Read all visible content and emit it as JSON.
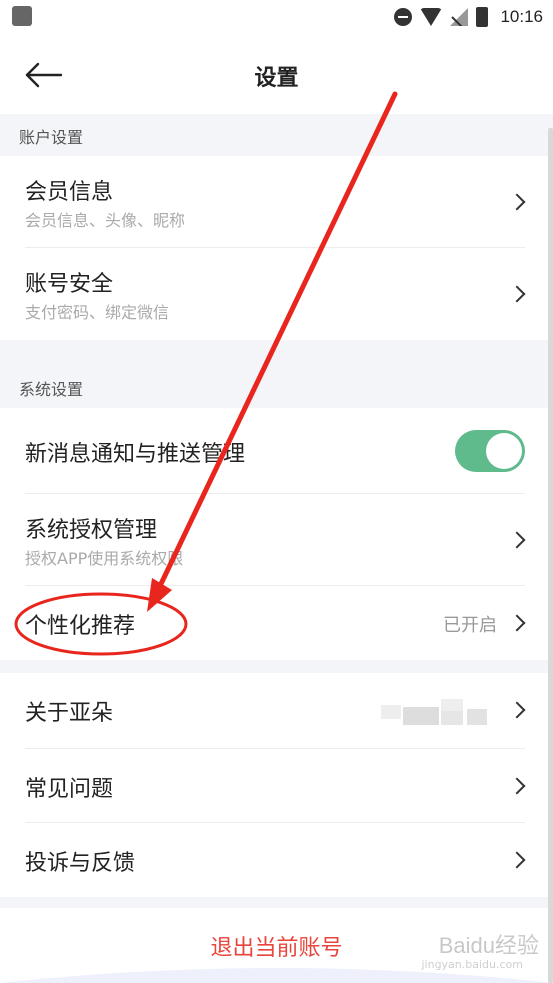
{
  "status_bar": {
    "time": "10:16"
  },
  "header": {
    "title": "设置"
  },
  "sections": {
    "account": {
      "title": "账户设置",
      "items": [
        {
          "label": "会员信息",
          "sub": "会员信息、头像、昵称"
        },
        {
          "label": "账号安全",
          "sub": "支付密码、绑定微信"
        }
      ]
    },
    "system": {
      "title": "系统设置",
      "items": [
        {
          "label": "新消息通知与推送管理",
          "toggle_on": true
        },
        {
          "label": "系统授权管理",
          "sub": "授权APP使用系统权限"
        },
        {
          "label": "个性化推荐",
          "value": "已开启"
        }
      ]
    },
    "other": {
      "items": [
        {
          "label": "关于亚朵"
        },
        {
          "label": "常见问题"
        },
        {
          "label": "投诉与反馈"
        }
      ]
    }
  },
  "logout": {
    "label": "退出当前账号"
  },
  "watermark": {
    "text": "Baidu经验",
    "sub": "jingyan.baidu.com"
  },
  "colors": {
    "toggle_on": "#5fba8c",
    "logout": "#e8453c",
    "annotation": "#e8261e"
  }
}
